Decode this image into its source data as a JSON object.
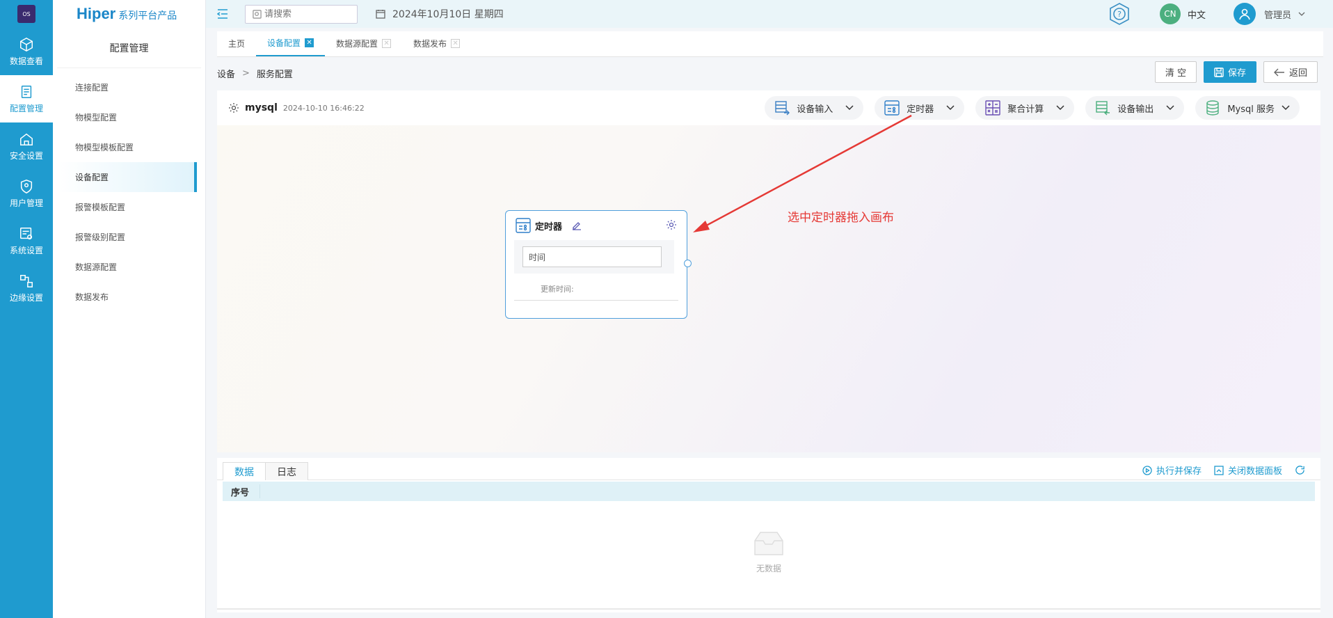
{
  "rail": {
    "logo": "OS",
    "items": [
      {
        "label": "数据查看",
        "icon": "cube-icon"
      },
      {
        "label": "配置管理",
        "icon": "config-icon"
      },
      {
        "label": "安全设置",
        "icon": "lock-icon"
      },
      {
        "label": "用户管理",
        "icon": "shield-icon"
      },
      {
        "label": "系统设置",
        "icon": "system-icon"
      },
      {
        "label": "边缘设置",
        "icon": "edge-icon"
      }
    ]
  },
  "sidebar": {
    "brand_main": "Hiper",
    "brand_sub": "系列平台产品",
    "title": "配置管理",
    "items": [
      {
        "label": "连接配置"
      },
      {
        "label": "物模型配置"
      },
      {
        "label": "物模型模板配置"
      },
      {
        "label": "设备配置"
      },
      {
        "label": "报警模板配置"
      },
      {
        "label": "报警级别配置"
      },
      {
        "label": "数据源配置"
      },
      {
        "label": "数据发布"
      }
    ]
  },
  "header": {
    "search_placeholder": "请搜索",
    "date": "2024年10月10日 星期四",
    "lang_badge": "CN",
    "lang_label": "中文",
    "user": "管理员"
  },
  "tabs": [
    {
      "label": "主页",
      "closable": false
    },
    {
      "label": "设备配置",
      "closable": true
    },
    {
      "label": "数据源配置",
      "closable": true
    },
    {
      "label": "数据发布",
      "closable": true
    }
  ],
  "breadcrumb": {
    "root": "设备",
    "sep": ">",
    "current": "服务配置"
  },
  "actions": {
    "clear": "清 空",
    "save": "保存",
    "back": "返回"
  },
  "canvas": {
    "name": "mysql",
    "timestamp": "2024-10-10 16:46:22",
    "node_buttons": [
      {
        "label": "设备输入"
      },
      {
        "label": "定时器"
      },
      {
        "label": "聚合计算"
      },
      {
        "label": "设备输出"
      },
      {
        "label": "Mysql 服务"
      }
    ],
    "timer_card": {
      "title": "定时器",
      "input": "时间",
      "updated": "更新时间:"
    },
    "hint": "选中定时器拖入画布"
  },
  "panel": {
    "tabs": [
      "数据",
      "日志"
    ],
    "exec_save": "执行并保存",
    "close_panel": "关闭数据面板",
    "col_index": "序号",
    "empty": "无数据"
  },
  "colors": {
    "primary": "#1f9bcf",
    "hint": "#e53935"
  }
}
